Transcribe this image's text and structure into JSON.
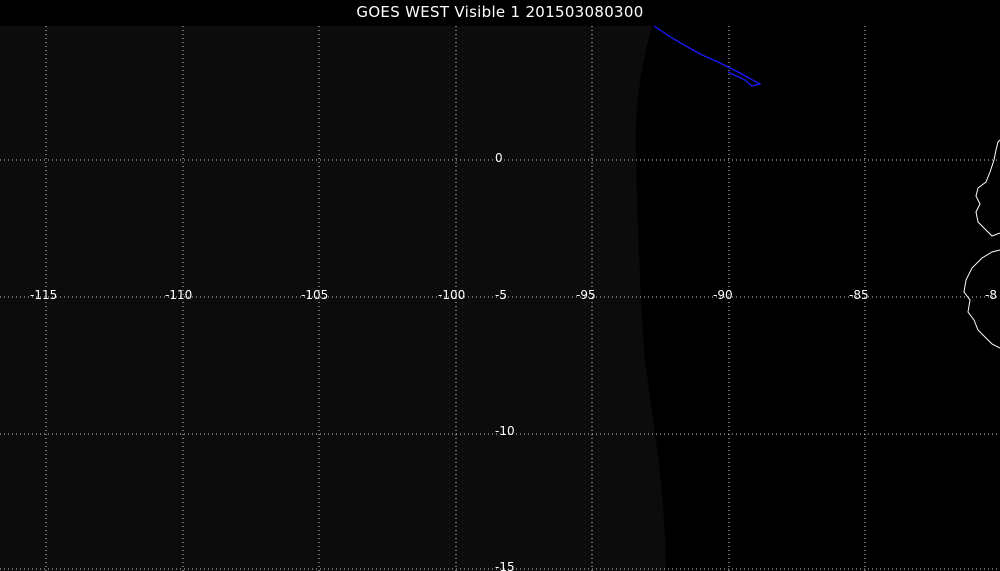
{
  "header": {
    "title": "GOES WEST Visible 1 201503080300"
  },
  "map": {
    "longitude_labels": [
      "-115",
      "-110",
      "-105",
      "-100",
      "-95",
      "-90",
      "-85",
      "-8"
    ],
    "latitude_labels": [
      "0",
      "-5",
      "-10",
      "-15"
    ],
    "colors": {
      "background": "#000000",
      "night_area": "#0c0c0c",
      "grid": "#d0d0d0",
      "coastline": "#ffffff",
      "boundary_line": "#1a1aff",
      "label": "#ffffff"
    }
  }
}
